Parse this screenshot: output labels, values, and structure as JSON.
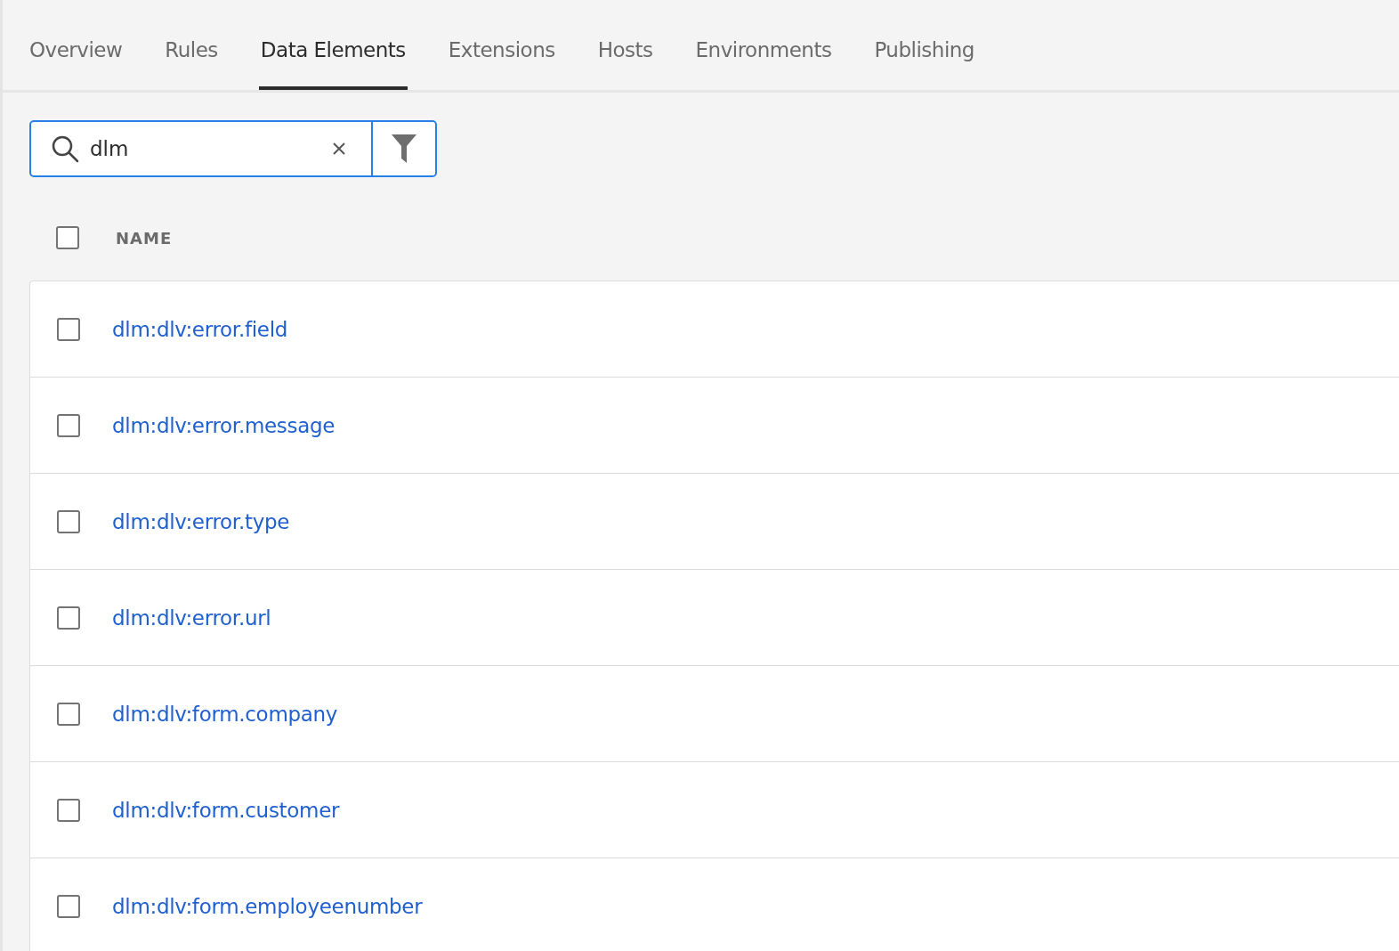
{
  "tabs": [
    {
      "label": "Overview",
      "selected": false
    },
    {
      "label": "Rules",
      "selected": false
    },
    {
      "label": "Data Elements",
      "selected": true
    },
    {
      "label": "Extensions",
      "selected": false
    },
    {
      "label": "Hosts",
      "selected": false
    },
    {
      "label": "Environments",
      "selected": false
    },
    {
      "label": "Publishing",
      "selected": false
    }
  ],
  "search": {
    "value": "dlm"
  },
  "table": {
    "select_all": {
      "checked": false
    },
    "columns": [
      "NAME"
    ],
    "rows": [
      {
        "name": "dlm:dlv:error.field",
        "checked": false
      },
      {
        "name": "dlm:dlv:error.message",
        "checked": false
      },
      {
        "name": "dlm:dlv:error.type",
        "checked": false
      },
      {
        "name": "dlm:dlv:error.url",
        "checked": false
      },
      {
        "name": "dlm:dlv:form.company",
        "checked": false
      },
      {
        "name": "dlm:dlv:form.customer",
        "checked": false
      },
      {
        "name": "dlm:dlv:form.employeenumber",
        "checked": false
      }
    ]
  }
}
